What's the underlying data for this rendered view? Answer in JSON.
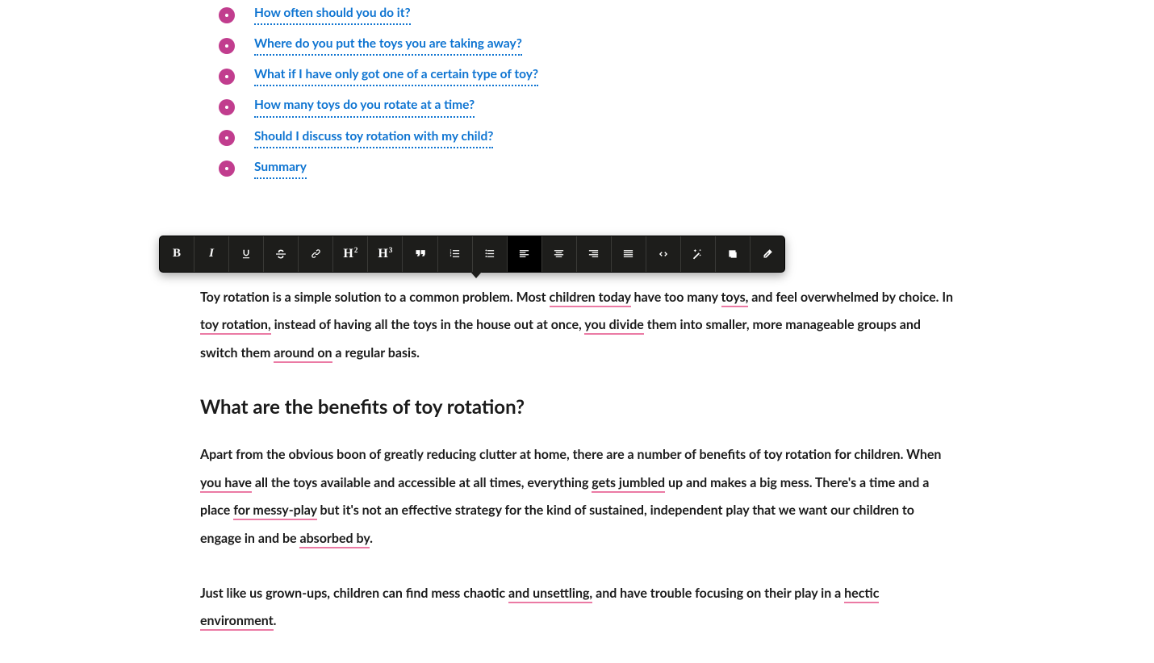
{
  "toc": {
    "items": [
      {
        "label": "How often should you do it?"
      },
      {
        "label": "Where do you put the toys you are taking away?"
      },
      {
        "label": "What if I have only got one of a certain type of toy?"
      },
      {
        "label": "How many toys do you rotate at a time?"
      },
      {
        "label": "Should I discuss toy rotation with my child?"
      },
      {
        "label": "Summary"
      }
    ]
  },
  "toolbar": {
    "bold": "B",
    "italic": "I",
    "h2_base": "H",
    "h2_sup": "2",
    "h3_base": "H",
    "h3_sup": "3",
    "active": "align-left"
  },
  "article": {
    "p1_parts": {
      "t0": "Toy rotation is a simple solution to a common problem. Most ",
      "s0": "children today",
      "t1": " have too many ",
      "s1": "toys,",
      "t2": " and feel overwhelmed by choice. In ",
      "s2": "toy rotation,",
      "t3": " instead of having all the toys in the house out at once, ",
      "s3": "you divide",
      "t4": " them into smaller, more manageable groups and switch them ",
      "s4": "around on",
      "t5": " a regular basis."
    },
    "h2": "What are the benefits of toy rotation?",
    "p2_parts": {
      "t0": "Apart from the obvious boon of greatly reducing clutter at home, there are a number of benefits of toy rotation for children. When ",
      "s0": "you have",
      "t1": " all the toys available and accessible at all times, everything ",
      "s1": "gets jumbled",
      "t2": " up and makes a big mess. There's a time and a place ",
      "s2": "for messy-play",
      "t3": " but it's not an effective strategy for the kind of sustained, independent play that we want our children to engage in and be ",
      "s3": "absorbed by",
      "t4": "."
    },
    "p3_parts": {
      "t0": "Just like us grown-ups, children can find mess chaotic ",
      "s0": "and unsettling,",
      "t1": " and have trouble focusing on their play in a ",
      "s1": "hectic environment",
      "t2": "."
    }
  }
}
